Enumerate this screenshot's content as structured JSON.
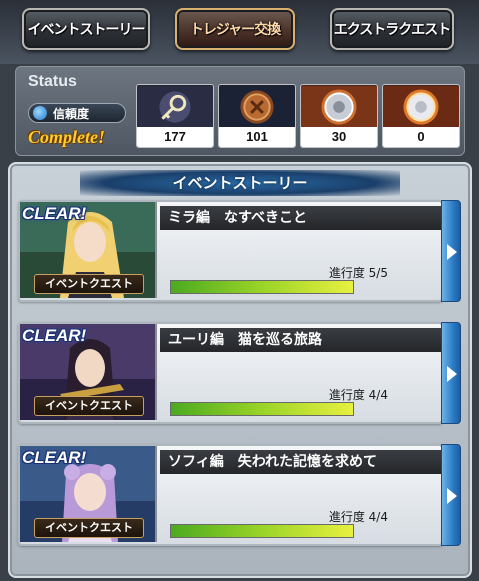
{
  "tabs": [
    {
      "label": "イベントストーリー",
      "active": false
    },
    {
      "label": "トレジャー交換",
      "active": true
    },
    {
      "label": "エクストラクエスト",
      "active": false
    }
  ],
  "status": {
    "title": "Status",
    "trust_label": "信頼度",
    "complete_text": "Complete!",
    "items": [
      {
        "icon": "key-treasure-icon",
        "count": "177"
      },
      {
        "icon": "bronze-medal-icon",
        "count": "101"
      },
      {
        "icon": "silver-orb-icon",
        "count": "30"
      },
      {
        "icon": "gold-orb-icon",
        "count": "0"
      }
    ]
  },
  "section": {
    "title": "イベントストーリー"
  },
  "quests": [
    {
      "badge": "CLEAR!",
      "thumb_label": "イベントクエスト",
      "title": "ミラ編　なすべきこと",
      "progress_text": "進行度 5/5",
      "progress": 1.0
    },
    {
      "badge": "CLEAR!",
      "thumb_label": "イベントクエスト",
      "title": "ユーリ編　猫を巡る旅路",
      "progress_text": "進行度 4/4",
      "progress": 1.0
    },
    {
      "badge": "CLEAR!",
      "thumb_label": "イベントクエスト",
      "title": "ソフィ編　失われた記憶を求めて",
      "progress_text": "進行度 4/4",
      "progress": 1.0
    }
  ],
  "colors": {
    "complete": "#ffcc30",
    "progress_start": "#4caa20",
    "progress_end": "#e8f040",
    "arrow_tab": "#2c7cc6"
  }
}
